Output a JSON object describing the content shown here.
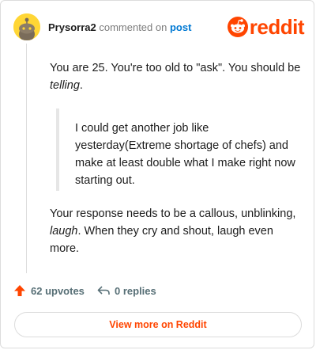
{
  "header": {
    "username": "Prysorra2",
    "action_text": "commented on",
    "post_link": "post",
    "logo_text": "reddit"
  },
  "comment": {
    "para1_text": "You are 25. You're too old to \"ask\". You should be ",
    "para1_em": "telling",
    "para1_end": ".",
    "quote": "I could get another job like yesterday(Extreme shortage of chefs) and make at least double what I make right now starting out.",
    "para3_text": "Your response needs to be a callous, unblinking, ",
    "para3_em": "laugh",
    "para3_end": ". When they cry and shout, laugh even more."
  },
  "actions": {
    "upvotes_label": "62 upvotes",
    "replies_label": "0 replies"
  },
  "view_more_label": "View more on Reddit",
  "colors": {
    "brand": "#ff4500",
    "link": "#0079d3",
    "avatar_bg": "#ffd635"
  },
  "icons": [
    "snoo-avatar-icon",
    "reddit-logo-icon",
    "upvote-arrow-icon",
    "reply-arrow-icon"
  ]
}
